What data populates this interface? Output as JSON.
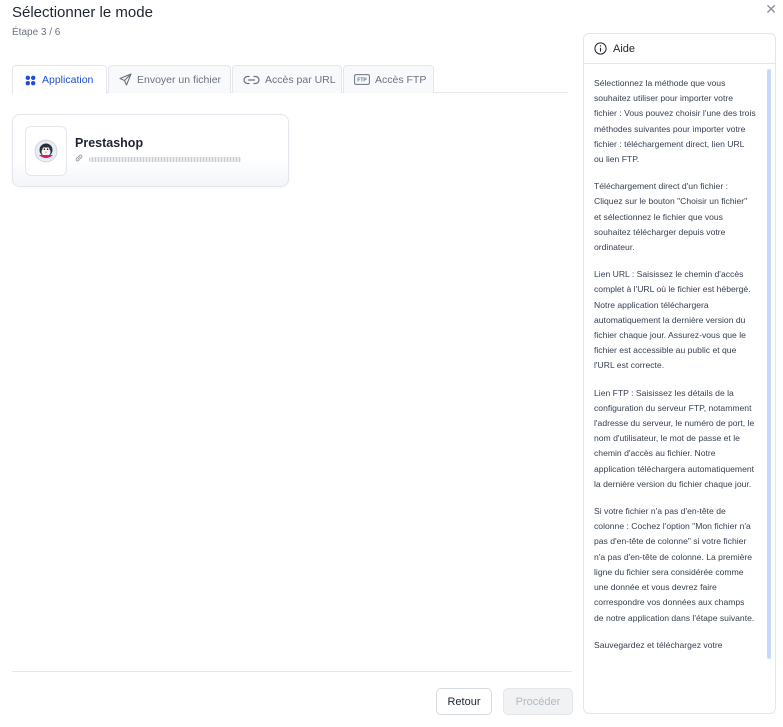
{
  "header": {
    "title": "Sélectionner le mode",
    "step": "Étape 3 / 6",
    "close_icon": "close-icon"
  },
  "tabs": [
    {
      "label": "Application",
      "icon": "grid-icon",
      "active": true
    },
    {
      "label": "Envoyer un fichier",
      "icon": "send-icon",
      "active": false
    },
    {
      "label": "Accès par URL",
      "icon": "link-icon",
      "active": false
    },
    {
      "label": "Accès FTP",
      "icon": "ftp-icon",
      "active": false
    }
  ],
  "app_card": {
    "name": "Prestashop",
    "logo": "prestashop-logo",
    "link_icon": "link-icon"
  },
  "footer": {
    "back_label": "Retour",
    "proceed_label": "Procéder"
  },
  "help": {
    "title": "Aide",
    "paragraphs": [
      "Sélectionnez la méthode que vous souhaitez utiliser pour importer votre fichier : Vous pouvez choisir l'une des trois méthodes suivantes pour importer votre fichier : téléchargement direct, lien URL ou lien FTP.",
      "Téléchargement direct d'un fichier : Cliquez sur le bouton \"Choisir un fichier\" et sélectionnez le fichier que vous souhaitez télécharger depuis votre ordinateur.",
      "Lien URL : Saisissez le chemin d'accès complet à l'URL où le fichier est hébergé. Notre application téléchargera automatiquement la dernière version du fichier chaque jour. Assurez-vous que le fichier est accessible au public et que l'URL est correcte.",
      "Lien FTP : Saisissez les détails de la configuration du serveur FTP, notamment l'adresse du serveur, le numéro de port, le nom d'utilisateur, le mot de passe et le chemin d'accès au fichier. Notre application téléchargera automatiquement la dernière version du fichier chaque jour.",
      "Si votre fichier n'a pas d'en-tête de colonne : Cochez l'option \"Mon fichier n'a pas d'en-tête de colonne\" si votre fichier n'a pas d'en-tête de colonne. La première ligne du fichier sera considérée comme une donnée et vous devrez faire correspondre vos données aux champs de notre application dans l'étape suivante.",
      "Sauvegardez et téléchargez votre"
    ]
  },
  "colors": {
    "accent": "#1d4ed8",
    "border": "#e5e7eb",
    "scrollbar": "#c9d7f8"
  }
}
